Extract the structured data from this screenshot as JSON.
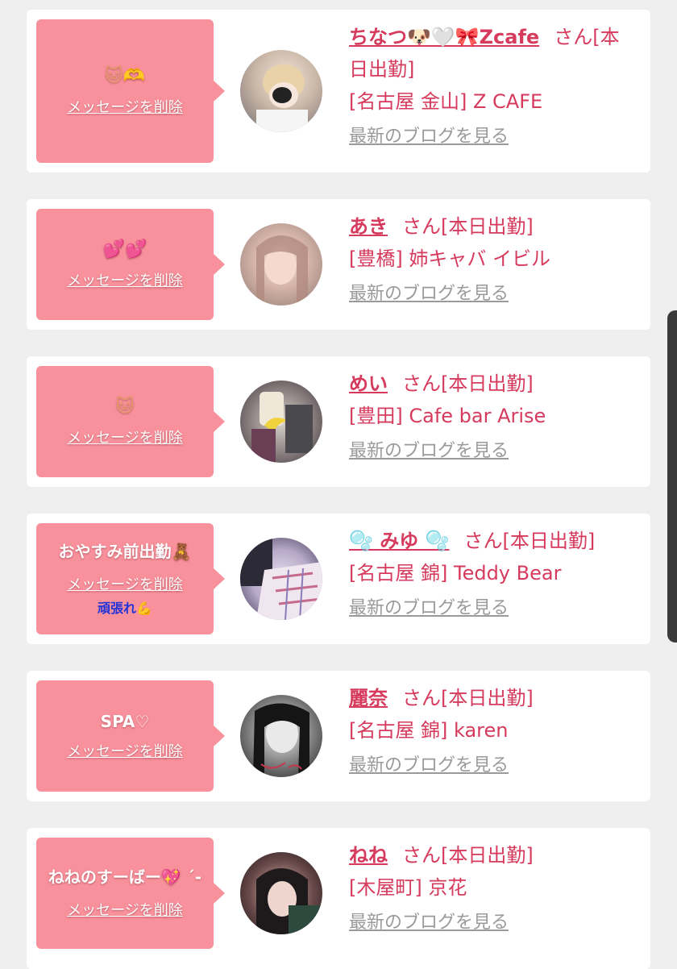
{
  "delete_label": "メッセージを削除",
  "blog_label": "最新のブログを見る",
  "entries": [
    {
      "message": "🐱🫶",
      "name": "ちなつ🐶🤍🎀Zcafe",
      "suffix": "さん[本日出勤]",
      "shop": "[名古屋 金山] Z CAFE"
    },
    {
      "message": "💕💕",
      "name": "あき",
      "suffix": "さん[本日出勤]",
      "shop": "[豊橋] 姉キャバ イビル"
    },
    {
      "message": "🐱",
      "name": "めい",
      "suffix": "さん[本日出勤]",
      "shop": "[豊田] Cafe bar Arise"
    },
    {
      "message": "おやすみ前出勤🧸",
      "sub_text": "頑張れ",
      "sub_emoji": "💪",
      "name": "🫧 みゆ 🫧",
      "suffix": "さん[本日出勤]",
      "shop": "[名古屋 錦] Teddy Bear"
    },
    {
      "message": "SPA♡",
      "name": "麗奈",
      "suffix": "さん[本日出勤]",
      "shop": "[名古屋 錦] karen"
    },
    {
      "message": "ねねのすーばー💖 ´-",
      "name": "ねね",
      "suffix": "さん[本日出勤]",
      "shop": "[木屋町] 京花"
    }
  ]
}
